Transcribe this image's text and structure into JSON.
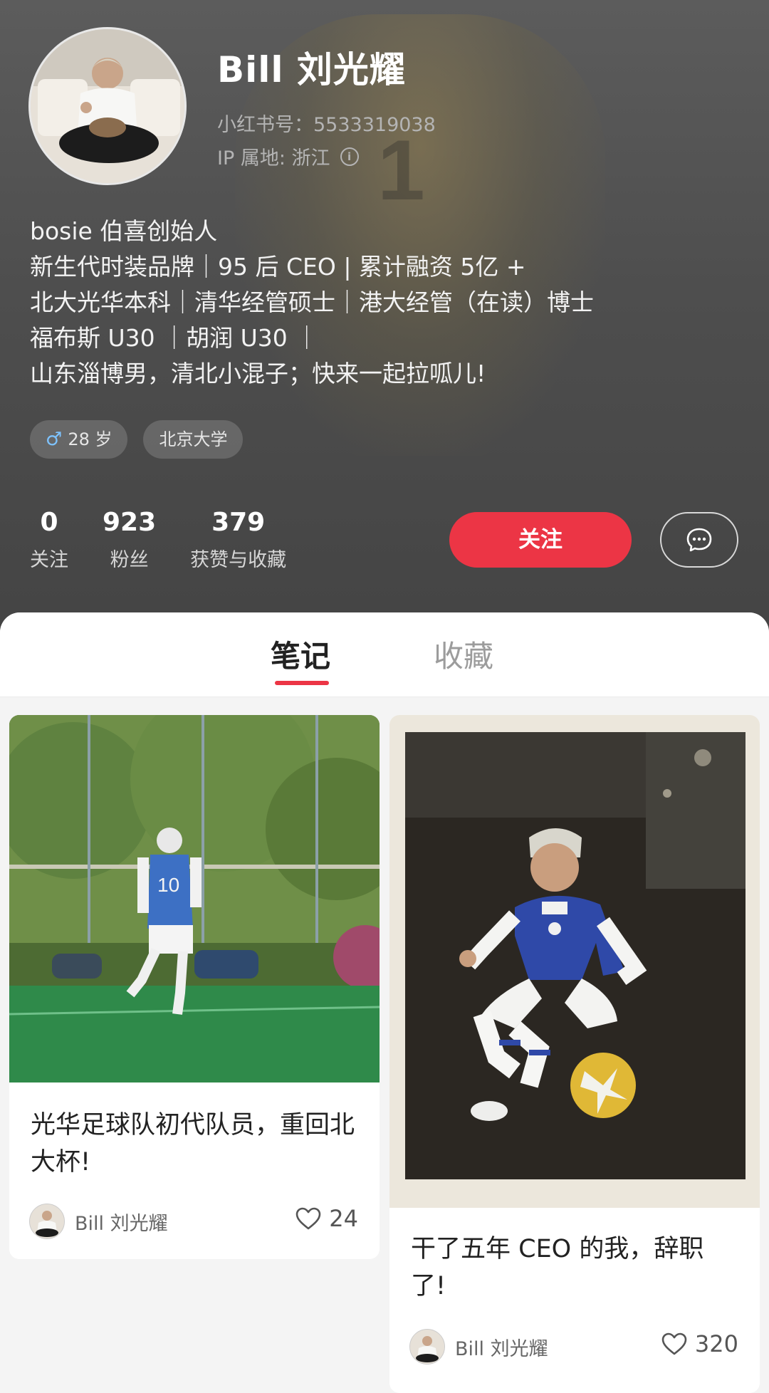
{
  "profile": {
    "display_name": "Bill 刘光耀",
    "user_id": "小红书号：5533319038",
    "ip_location": "IP 属地: 浙江",
    "info_glyph": "i",
    "bio": [
      "bosie 伯喜创始人",
      "新生代时装品牌｜95 后 CEO | 累计融资 5亿 +",
      "北大光华本科｜清华经管硕士｜港大经管（在读）博士",
      "福布斯 U30 ｜胡润 U30 ｜",
      "山东淄博男，清北小混子；快来一起拉呱儿!"
    ],
    "tags": {
      "age": "28 岁",
      "gender_icon": "♂",
      "school": "北京大学"
    },
    "stats": [
      {
        "value": "0",
        "label": "关注"
      },
      {
        "value": "923",
        "label": "粉丝"
      },
      {
        "value": "379",
        "label": "获赞与收藏"
      }
    ],
    "follow_label": "关注",
    "message_icon": "chat-bubble-icon"
  },
  "tabs": {
    "notes": "笔记",
    "collect": "收藏",
    "active": "notes"
  },
  "notes": [
    {
      "title": "光华足球队初代队员，重回北大杯!",
      "author": "Bill 刘光耀",
      "likes": "24"
    },
    {
      "title": "干了五年 CEO 的我，辞职了!",
      "author": "Bill 刘光耀",
      "likes": "320"
    }
  ],
  "colors": {
    "accent": "#ec3545",
    "header_bg": "#4e4e4e",
    "page_bg": "#f4f4f4"
  }
}
